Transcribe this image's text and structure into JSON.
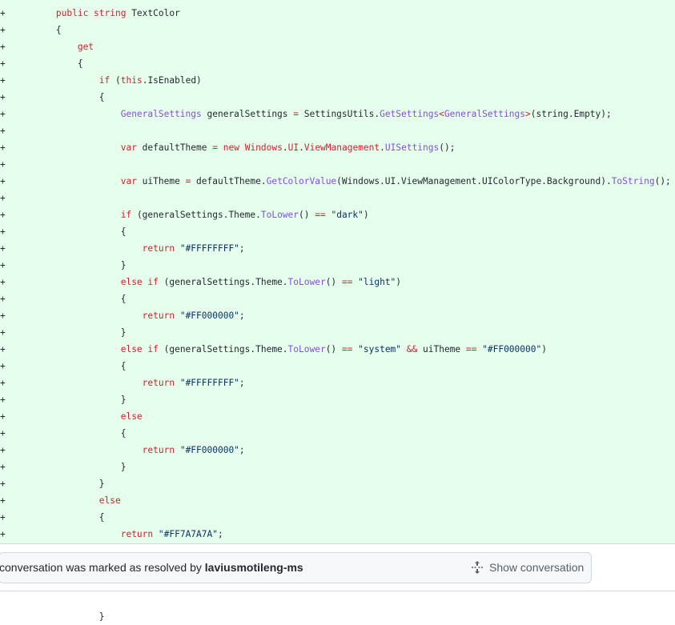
{
  "diff": {
    "added_marker": "+",
    "lines": [
      [
        {
          "t": "        "
        },
        {
          "t": "public string",
          "c": "kw"
        },
        {
          "t": " TextColor"
        }
      ],
      [
        {
          "t": "        {"
        }
      ],
      [
        {
          "t": "            "
        },
        {
          "t": "get",
          "c": "kw"
        }
      ],
      [
        {
          "t": "            {"
        }
      ],
      [
        {
          "t": "                "
        },
        {
          "t": "if",
          "c": "kw"
        },
        {
          "t": " ("
        },
        {
          "t": "this",
          "c": "kw"
        },
        {
          "t": ".IsEnabled)"
        }
      ],
      [
        {
          "t": "                {"
        }
      ],
      [
        {
          "t": "                    "
        },
        {
          "t": "GeneralSettings",
          "c": "ty"
        },
        {
          "t": " generalSettings "
        },
        {
          "t": "=",
          "c": "kw"
        },
        {
          "t": " SettingsUtils."
        },
        {
          "t": "GetSettings",
          "c": "ty"
        },
        {
          "t": "<",
          "c": "kw"
        },
        {
          "t": "GeneralSettings",
          "c": "ty"
        },
        {
          "t": ">",
          "c": "kw"
        },
        {
          "t": "(string.Empty);"
        }
      ],
      [
        {
          "t": ""
        }
      ],
      [
        {
          "t": "                    "
        },
        {
          "t": "var",
          "c": "kw"
        },
        {
          "t": " defaultTheme "
        },
        {
          "t": "=",
          "c": "kw"
        },
        {
          "t": " "
        },
        {
          "t": "new",
          "c": "kw"
        },
        {
          "t": " "
        },
        {
          "t": "Windows",
          "c": "kw"
        },
        {
          "t": "."
        },
        {
          "t": "UI",
          "c": "kw"
        },
        {
          "t": "."
        },
        {
          "t": "ViewManagement",
          "c": "kw"
        },
        {
          "t": "."
        },
        {
          "t": "UISettings",
          "c": "ty"
        },
        {
          "t": "();"
        }
      ],
      [
        {
          "t": ""
        }
      ],
      [
        {
          "t": "                    "
        },
        {
          "t": "var",
          "c": "kw"
        },
        {
          "t": " uiTheme "
        },
        {
          "t": "=",
          "c": "kw"
        },
        {
          "t": " defaultTheme."
        },
        {
          "t": "GetColorValue",
          "c": "ty"
        },
        {
          "t": "(Windows.UI.ViewManagement.UIColorType.Background)."
        },
        {
          "t": "ToString",
          "c": "ty"
        },
        {
          "t": "();"
        }
      ],
      [
        {
          "t": ""
        }
      ],
      [
        {
          "t": "                    "
        },
        {
          "t": "if",
          "c": "kw"
        },
        {
          "t": " (generalSettings.Theme."
        },
        {
          "t": "ToLower",
          "c": "ty"
        },
        {
          "t": "() "
        },
        {
          "t": "==",
          "c": "kw"
        },
        {
          "t": " "
        },
        {
          "t": "\"dark\"",
          "c": "st"
        },
        {
          "t": ")"
        }
      ],
      [
        {
          "t": "                    {"
        }
      ],
      [
        {
          "t": "                        "
        },
        {
          "t": "return",
          "c": "kw"
        },
        {
          "t": " "
        },
        {
          "t": "\"#FFFFFFFF\"",
          "c": "st"
        },
        {
          "t": ";"
        }
      ],
      [
        {
          "t": "                    }"
        }
      ],
      [
        {
          "t": "                    "
        },
        {
          "t": "else if",
          "c": "kw"
        },
        {
          "t": " (generalSettings.Theme."
        },
        {
          "t": "ToLower",
          "c": "ty"
        },
        {
          "t": "() "
        },
        {
          "t": "==",
          "c": "kw"
        },
        {
          "t": " "
        },
        {
          "t": "\"light\"",
          "c": "st"
        },
        {
          "t": ")"
        }
      ],
      [
        {
          "t": "                    {"
        }
      ],
      [
        {
          "t": "                        "
        },
        {
          "t": "return",
          "c": "kw"
        },
        {
          "t": " "
        },
        {
          "t": "\"#FF000000\"",
          "c": "st"
        },
        {
          "t": ";"
        }
      ],
      [
        {
          "t": "                    }"
        }
      ],
      [
        {
          "t": "                    "
        },
        {
          "t": "else if",
          "c": "kw"
        },
        {
          "t": " (generalSettings.Theme."
        },
        {
          "t": "ToLower",
          "c": "ty"
        },
        {
          "t": "() "
        },
        {
          "t": "==",
          "c": "kw"
        },
        {
          "t": " "
        },
        {
          "t": "\"system\"",
          "c": "st"
        },
        {
          "t": " "
        },
        {
          "t": "&&",
          "c": "kw"
        },
        {
          "t": " uiTheme "
        },
        {
          "t": "==",
          "c": "kw"
        },
        {
          "t": " "
        },
        {
          "t": "\"#FF000000\"",
          "c": "st"
        },
        {
          "t": ")"
        }
      ],
      [
        {
          "t": "                    {"
        }
      ],
      [
        {
          "t": "                        "
        },
        {
          "t": "return",
          "c": "kw"
        },
        {
          "t": " "
        },
        {
          "t": "\"#FFFFFFFF\"",
          "c": "st"
        },
        {
          "t": ";"
        }
      ],
      [
        {
          "t": "                    }"
        }
      ],
      [
        {
          "t": "                    "
        },
        {
          "t": "else",
          "c": "kw"
        }
      ],
      [
        {
          "t": "                    {"
        }
      ],
      [
        {
          "t": "                        "
        },
        {
          "t": "return",
          "c": "kw"
        },
        {
          "t": " "
        },
        {
          "t": "\"#FF000000\"",
          "c": "st"
        },
        {
          "t": ";"
        }
      ],
      [
        {
          "t": "                    }"
        }
      ],
      [
        {
          "t": "                }"
        }
      ],
      [
        {
          "t": "                "
        },
        {
          "t": "else",
          "c": "kw"
        }
      ],
      [
        {
          "t": "                {"
        }
      ],
      [
        {
          "t": "                    "
        },
        {
          "t": "return",
          "c": "kw"
        },
        {
          "t": " "
        },
        {
          "t": "\"#FF7A7A7A\"",
          "c": "st"
        },
        {
          "t": ";"
        }
      ]
    ]
  },
  "resolved": {
    "text": "conversation was marked as resolved by ",
    "user": "laviusmotileng-ms",
    "show_label": "Show conversation",
    "show_icon": "unfold-icon"
  },
  "tail_line": "                }",
  "colors": {
    "added_bg": "#e6ffec",
    "keyword": "#cf222e",
    "type": "#8250df",
    "string": "#0a3069",
    "text": "#24292f"
  }
}
